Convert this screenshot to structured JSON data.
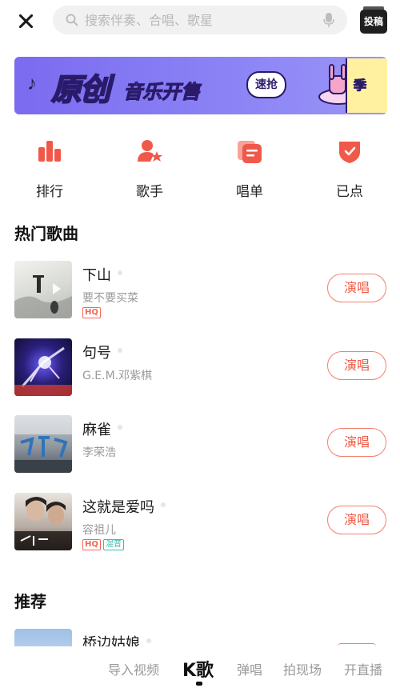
{
  "header": {
    "search_placeholder": "搜索伴奏、合唱、歌星",
    "post_label": "投稿"
  },
  "banner": {
    "title_main": "原创",
    "title_sub": "音乐开售",
    "cta": "速抢",
    "card_text": "季"
  },
  "categories": [
    {
      "label": "排行",
      "icon": "chart-bars-icon"
    },
    {
      "label": "歌手",
      "icon": "singer-star-icon"
    },
    {
      "label": "唱单",
      "icon": "playlist-icon"
    },
    {
      "label": "已点",
      "icon": "checked-shield-icon"
    }
  ],
  "hot_section": {
    "title": "热门歌曲"
  },
  "songs": [
    {
      "title": "下山",
      "artist": "要不要买菜",
      "tags": [
        "HQ"
      ],
      "action": "演唱"
    },
    {
      "title": "句号",
      "artist": "G.E.M.邓紫棋",
      "tags": [],
      "action": "演唱"
    },
    {
      "title": "麻雀",
      "artist": "李荣浩",
      "tags": [],
      "action": "演唱"
    },
    {
      "title": "这就是爱吗",
      "artist": "容祖儿",
      "tags": [
        "HQ",
        "混音"
      ],
      "action": "演唱"
    }
  ],
  "recommend_section": {
    "title": "推荐"
  },
  "recommend_songs": [
    {
      "title": "桥边姑娘"
    }
  ],
  "bottom_nav": {
    "items": [
      "导入视频",
      "K歌",
      "弹唱",
      "拍现场",
      "开直播"
    ],
    "active": "K歌"
  },
  "colors": {
    "accent": "#f05a45",
    "banner_bg": "#8a82f5"
  }
}
